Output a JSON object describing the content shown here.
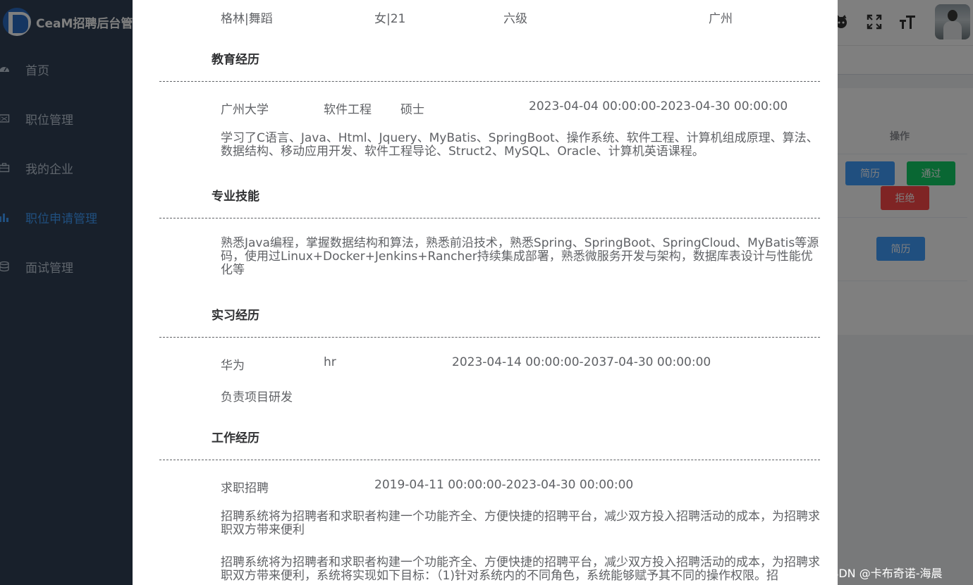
{
  "app": {
    "title": "CeaM招聘后台管理"
  },
  "sidebar": {
    "items": [
      {
        "label": "首页",
        "icon": "dashboard-icon",
        "active": false
      },
      {
        "label": "职位管理",
        "icon": "mail-icon",
        "active": false
      },
      {
        "label": "我的企业",
        "icon": "briefcase-icon",
        "active": false
      },
      {
        "label": "职位申请管理",
        "icon": "bar-chart-icon",
        "active": true
      },
      {
        "label": "面试管理",
        "icon": "database-icon",
        "active": false
      }
    ]
  },
  "navbar": {
    "icons": [
      "github-icon",
      "fullscreen-icon",
      "font-size-icon"
    ],
    "avatar": "user-avatar"
  },
  "table": {
    "operation_header": "操作",
    "row1": {
      "resume": "简历",
      "pass": "通过",
      "reject": "拒绝"
    },
    "row2": {
      "resume": "简历"
    }
  },
  "resume": {
    "basic": {
      "name": "格林|舞蹈",
      "gender_age": "女|21",
      "english": "六级",
      "city": "广州"
    },
    "education": {
      "title": "教育经历",
      "school": "广州大学",
      "major": "软件工程",
      "degree": "硕士",
      "period": "2023-04-04 00:00:00-2023-04-30 00:00:00",
      "desc": "学习了C语言、Java、Html、Jquery、MyBatis、SpringBoot、操作系统、软件工程、计算机组成原理、算法、数据结构、移动应用开发、软件工程导论、Struct2、MySQL、Oracle、计算机英语课程。"
    },
    "skills": {
      "title": "专业技能",
      "desc": "熟悉Java编程，掌握数据结构和算法，熟悉前沿技术，熟悉Spring、SpringBoot、SpringCloud、MyBatis等源码，使用过Linux+Docker+Jenkins+Rancher持续集成部署，熟悉微服务开发与架构，数据库表设计与性能优化等"
    },
    "internship": {
      "title": "实习经历",
      "company": "华为",
      "position": "hr",
      "period": "2023-04-14 00:00:00-2037-04-30 00:00:00",
      "desc": "负责项目研发"
    },
    "work": {
      "title": "工作经历",
      "project": "求职招聘",
      "period": "2019-04-11 00:00:00-2023-04-30 00:00:00",
      "desc1": "招聘系统将为招聘者和求职者构建一个功能齐全、方便快捷的招聘平台，减少双方投入招聘活动的成本，为招聘求职双方带来便利",
      "desc2": "招聘系统将为招聘者和求职者构建一个功能齐全、方便快捷的招聘平台，减少双方投入招聘活动的成本，为招聘求职双方带来便利，系统将实现如下目标：（1)针对系统内的不同角色，系统能够赋予其不同的操作权限。招"
    }
  },
  "watermark": "CSDN @卡布奇诺-海晨"
}
